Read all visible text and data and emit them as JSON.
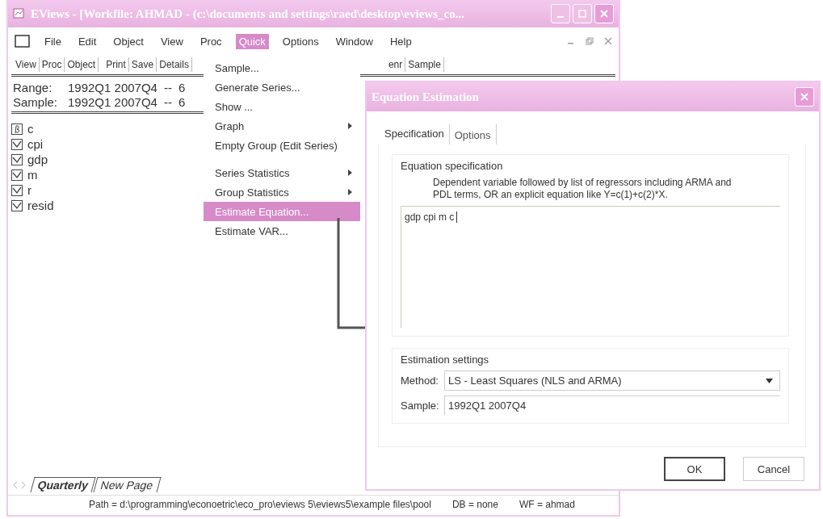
{
  "window": {
    "title": "EViews - [Workfile: AHMAD - (c:\\documents and settings\\raed\\desktop\\eviews_co..."
  },
  "menu_bar": [
    {
      "label": "File",
      "selected": false
    },
    {
      "label": "Edit",
      "selected": false
    },
    {
      "label": "Object",
      "selected": false
    },
    {
      "label": "View",
      "selected": false
    },
    {
      "label": "Proc",
      "selected": false
    },
    {
      "label": "Quick",
      "selected": true
    },
    {
      "label": "Options",
      "selected": false
    },
    {
      "label": "Window",
      "selected": false
    },
    {
      "label": "Help",
      "selected": false
    }
  ],
  "toolbar_left": [
    "View",
    "Proc",
    "Object",
    "Print",
    "Save",
    "Details"
  ],
  "toolbar_right": [
    "enr",
    "Sample"
  ],
  "range": {
    "label": "Range:",
    "value": "1992Q1 2007Q4",
    "sep": "--",
    "count": "6"
  },
  "sample": {
    "label": "Sample:",
    "value": "1992Q1 2007Q4",
    "sep": "--",
    "count": "6"
  },
  "objects": [
    {
      "name": "c",
      "kind": "coef"
    },
    {
      "name": "cpi",
      "kind": "series"
    },
    {
      "name": "gdp",
      "kind": "series"
    },
    {
      "name": "m",
      "kind": "series"
    },
    {
      "name": "r",
      "kind": "series"
    },
    {
      "name": "resid",
      "kind": "series"
    }
  ],
  "page_tabs": [
    {
      "label": "Quarterly",
      "selected": true
    },
    {
      "label": "New Page",
      "selected": false
    }
  ],
  "status_bar": [
    "Path = d:\\programming\\econoetric\\eco_pro\\eviews 5\\eviews5\\example files\\pool",
    "DB = none",
    "WF = ahmad"
  ],
  "quick_menu": [
    {
      "kind": "item",
      "label": "Sample...",
      "submenu": false,
      "selected": false
    },
    {
      "kind": "item",
      "label": "Generate Series...",
      "submenu": false,
      "selected": false
    },
    {
      "kind": "item",
      "label": "Show ...",
      "submenu": false,
      "selected": false
    },
    {
      "kind": "item",
      "label": "Graph",
      "submenu": true,
      "selected": false
    },
    {
      "kind": "item",
      "label": "Empty Group (Edit Series)",
      "submenu": false,
      "selected": false
    },
    {
      "kind": "separator"
    },
    {
      "kind": "item",
      "label": "Series Statistics",
      "submenu": true,
      "selected": false
    },
    {
      "kind": "item",
      "label": "Group Statistics",
      "submenu": true,
      "selected": false
    },
    {
      "kind": "item",
      "label": "Estimate Equation...",
      "submenu": false,
      "selected": true
    },
    {
      "kind": "item",
      "label": "Estimate VAR...",
      "submenu": false,
      "selected": false
    }
  ],
  "dialog": {
    "title": "Equation Estimation",
    "tabs": [
      {
        "label": "Specification",
        "selected": true
      },
      {
        "label": "Options",
        "selected": false
      }
    ],
    "spec_group": "Equation specification",
    "hint": "Dependent variable followed by list of regressors including ARMA and PDL terms, OR an explicit equation like Y=c(1)+c(2)*X.",
    "equation": "gdp cpi m c",
    "settings_group": "Estimation settings",
    "method_label": "Method:",
    "method": "LS  -  Least Squares (NLS and ARMA)",
    "sample_label": "Sample:",
    "sample": "1992Q1 2007Q4",
    "buttons": [
      {
        "label": "OK",
        "default": true
      },
      {
        "label": "Cancel",
        "default": false
      }
    ]
  }
}
